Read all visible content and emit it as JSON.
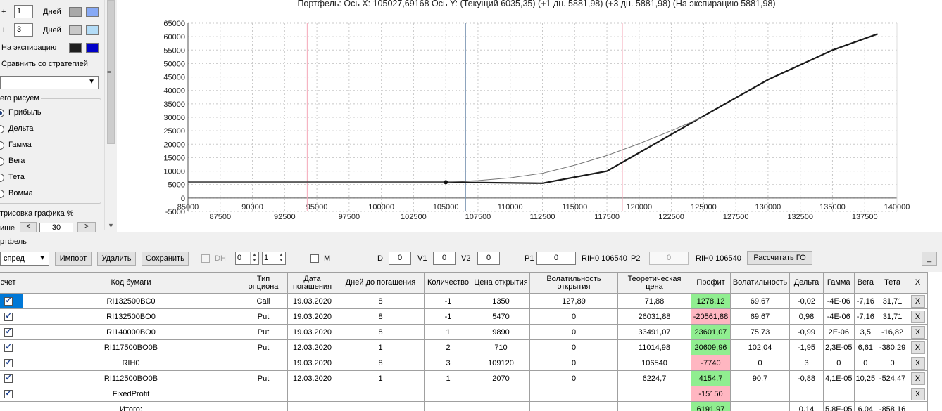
{
  "chart": {
    "title": "Портфель: Ось X: 105027,69168 Ось Y:  (Текущий 6035,35)  (+1 дн. 5881,98)  (+3 дн. 5881,98)  (На экспирацию 5881,98)",
    "colors": {
      "line_expiry": "#1a1a1a",
      "line_current": "#777777",
      "grid": "#c8c8c8",
      "marker_red": "#f4a8b8",
      "marker_blue": "#7e98b4"
    }
  },
  "chart_data": {
    "type": "line",
    "xlim": [
      85000,
      140000
    ],
    "ylim": [
      -5000,
      65000
    ],
    "x_ticks_top": [
      85000,
      90000,
      95000,
      100000,
      105000,
      110000,
      115000,
      120000,
      125000,
      130000,
      135000,
      140000
    ],
    "x_ticks_bottom": [
      87500,
      92500,
      97500,
      102500,
      107500,
      112500,
      117500,
      122500,
      127500,
      132500,
      137500
    ],
    "y_ticks": [
      -5000,
      0,
      5000,
      10000,
      15000,
      20000,
      25000,
      30000,
      35000,
      40000,
      45000,
      50000,
      55000,
      60000,
      65000
    ],
    "vertical_markers": [
      {
        "x": 94250,
        "color": "#f4a8b8"
      },
      {
        "x": 106540,
        "color": "#7e98b4"
      },
      {
        "x": 118700,
        "color": "#f4a8b8"
      }
    ],
    "point": {
      "x": 105000,
      "y": 5882
    },
    "series": [
      {
        "style": "expiry",
        "x": [
          85000,
          105000,
          112500,
          117500,
          125000,
          130000,
          135000,
          138500
        ],
        "y": [
          5882,
          5882,
          5500,
          10000,
          30500,
          44000,
          55000,
          61000
        ]
      },
      {
        "style": "current",
        "x": [
          85000,
          100000,
          105000,
          107500,
          110000,
          112500,
          115000,
          117500,
          120000,
          122500,
          125000
        ],
        "y": [
          5882,
          5882,
          5950,
          6500,
          7500,
          9200,
          12200,
          15800,
          20200,
          25000,
          30300
        ]
      }
    ]
  },
  "settings": {
    "row1": {
      "plus": "+",
      "value": "1",
      "label": "Дней",
      "color_a": "#a9a9a9",
      "color_b": "#87a9f5"
    },
    "row2": {
      "plus": "+",
      "value": "3",
      "label": "Дней",
      "color_a": "#c8c8c8",
      "color_b": "#b3dcf7"
    },
    "expiry": {
      "label": "На экспирацию",
      "color_a": "#1e1e1e",
      "color_b": "#0000c8"
    },
    "compare_label": "Сравнить со стратегией",
    "compare_value": "",
    "group_title": "его рисуем",
    "radio": [
      "Прибыль",
      "Дельта",
      "Гамма",
      "Вега",
      "Тета",
      "Вомма"
    ],
    "render_label": "трисовка графика %",
    "bottom_text": "ише",
    "bottom_value": "30",
    "bottom_minus": "<",
    "bottom_plus": ">"
  },
  "portfolio": {
    "title": "ртфель",
    "strategy_value": "спред",
    "buttons": {
      "import": "Импорт",
      "delete": "Удалить",
      "save": "Сохранить",
      "calc": "Рассчитать ГО",
      "minimize": "_"
    },
    "dh_label": "DH",
    "spin1": "0",
    "spin2": "1",
    "m_label": "M",
    "d_label": "D",
    "d_value": "0",
    "v1_label": "V1",
    "v1_value": "0",
    "v2_label": "V2",
    "v2_value": "0",
    "p1_label": "P1",
    "p1_value": "0",
    "rih1": "RIH0 106540",
    "p2_label": "P2",
    "p2_value": "0",
    "rih2": "RIH0 106540"
  },
  "table": {
    "headers": [
      "счет",
      "Код бумаги",
      "Тип опциона",
      "Дата погашения",
      "Дней до погашения",
      "Количество",
      "Цена открытия",
      "Волатильность открытия",
      "Теоретическая цена",
      "Профит",
      "Волатильность",
      "Дельта",
      "Гамма",
      "Вега",
      "Тета",
      "X"
    ],
    "delete_label": "X",
    "rows": [
      {
        "code": "RI132500BC0",
        "type": "Call",
        "date": "19.03.2020",
        "days": "8",
        "qty": "-1",
        "open_price": "1350",
        "open_vol": "127,89",
        "theo": "71,88",
        "profit": "1278,12",
        "profit_sign": "pos",
        "vol": "69,67",
        "delta": "-0,02",
        "gamma": "-4E-06",
        "vega": "-7,16",
        "theta": "31,71",
        "checked": true,
        "del": true
      },
      {
        "code": "RI132500BO0",
        "type": "Put",
        "date": "19.03.2020",
        "days": "8",
        "qty": "-1",
        "open_price": "5470",
        "open_vol": "0",
        "theo": "26031,88",
        "profit": "-20561,88",
        "profit_sign": "neg",
        "vol": "69,67",
        "delta": "0,98",
        "gamma": "-4E-06",
        "vega": "-7,16",
        "theta": "31,71",
        "checked": true,
        "del": true
      },
      {
        "code": "RI140000BO0",
        "type": "Put",
        "date": "19.03.2020",
        "days": "8",
        "qty": "1",
        "open_price": "9890",
        "open_vol": "0",
        "theo": "33491,07",
        "profit": "23601,07",
        "profit_sign": "pos",
        "vol": "75,73",
        "delta": "-0,99",
        "gamma": "2E-06",
        "vega": "3,5",
        "theta": "-16,82",
        "checked": true,
        "del": true
      },
      {
        "code": "RI117500BO0B",
        "type": "Put",
        "date": "12.03.2020",
        "days": "1",
        "qty": "2",
        "open_price": "710",
        "open_vol": "0",
        "theo": "11014,98",
        "profit": "20609,96",
        "profit_sign": "pos",
        "vol": "102,04",
        "delta": "-1,95",
        "gamma": "2,3E-05",
        "vega": "6,61",
        "theta": "-380,29",
        "checked": true,
        "del": true
      },
      {
        "code": "RIH0",
        "type": "",
        "date": "19.03.2020",
        "days": "8",
        "qty": "3",
        "open_price": "109120",
        "open_vol": "0",
        "theo": "106540",
        "profit": "-7740",
        "profit_sign": "neg",
        "vol": "0",
        "delta": "3",
        "gamma": "0",
        "vega": "0",
        "theta": "0",
        "checked": true,
        "del": true
      },
      {
        "code": "RI112500BO0B",
        "type": "Put",
        "date": "12.03.2020",
        "days": "1",
        "qty": "1",
        "open_price": "2070",
        "open_vol": "0",
        "theo": "6224,7",
        "profit": "4154,7",
        "profit_sign": "pos",
        "vol": "90,7",
        "delta": "-0,88",
        "gamma": "4,1E-05",
        "vega": "10,25",
        "theta": "-524,47",
        "checked": true,
        "del": true
      },
      {
        "code": "FixedProfit",
        "type": "",
        "date": "",
        "days": "",
        "qty": "",
        "open_price": "",
        "open_vol": "",
        "theo": "",
        "profit": "-15150",
        "profit_sign": "neg",
        "vol": "",
        "delta": "",
        "gamma": "",
        "vega": "",
        "theta": "",
        "checked": true,
        "del": true
      },
      {
        "code": "Итого:",
        "type": "",
        "date": "",
        "days": "",
        "qty": "",
        "open_price": "",
        "open_vol": "",
        "theo": "",
        "profit": "6191,97",
        "profit_sign": "pos",
        "vol": "",
        "delta": "0,14",
        "gamma": "5,8E-05",
        "vega": "6,04",
        "theta": "-858,16",
        "checked": false,
        "del": false
      }
    ]
  }
}
